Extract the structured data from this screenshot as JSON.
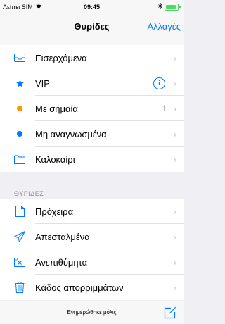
{
  "status_bar": {
    "carrier": "Λείπει SIM",
    "time": "09:45"
  },
  "nav": {
    "title": "Θυρίδες",
    "edit_label": "Αλλαγές"
  },
  "mailboxes": [
    {
      "label": "Εισερχόμενα",
      "icon": "inbox-icon"
    },
    {
      "label": "VIP",
      "icon": "star-icon"
    },
    {
      "label": "Με σημαία",
      "icon": "orange-dot-icon",
      "count": "1"
    },
    {
      "label": "Μη αναγνωσμένα",
      "icon": "blue-dot-icon"
    },
    {
      "label": "Καλοκαίρι",
      "icon": "folder-icon"
    }
  ],
  "section": {
    "header": "ΘΥΡΙΔΕΣ"
  },
  "folders": [
    {
      "label": "Πρόχειρα",
      "icon": "document-icon"
    },
    {
      "label": "Απεσταλμένα",
      "icon": "paper-plane-icon"
    },
    {
      "label": "Ανεπιθύμητα",
      "icon": "junk-tray-icon"
    },
    {
      "label": "Κάδος απορριμμάτων",
      "icon": "trash-icon"
    }
  ],
  "toolbar": {
    "status": "Ενημερώθηκε μόλις"
  },
  "colors": {
    "accent": "#007aff",
    "flag": "#ff9500",
    "unread": "#007aff",
    "battery": "#4cd964"
  }
}
